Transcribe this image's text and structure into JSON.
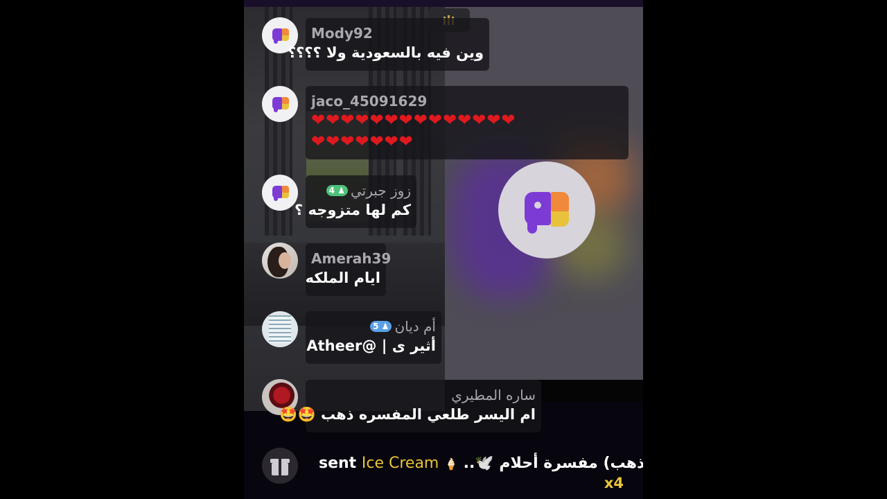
{
  "colors": {
    "accent": "#e9c43a",
    "heart": "#e0191f",
    "username": "#aaa8ae"
  },
  "comments": [
    {
      "username": "Mody92",
      "message": "وين فيه بالسعودية ولا ؟؟؟؟",
      "avatar": "app-logo-icon"
    },
    {
      "username": "jaco_45091629",
      "hearts_line1": "❤❤❤❤❤❤❤❤❤❤❤❤❤❤",
      "hearts_line2": "❤❤❤❤❤❤❤",
      "avatar": "app-logo-icon"
    },
    {
      "username": "زوز جبرتي",
      "level": "4",
      "message": "كم لها متزوجه ؟",
      "avatar": "app-logo-icon"
    },
    {
      "username": "Amerah39",
      "message": "ايام الملكه",
      "avatar": "user-photo"
    },
    {
      "username": "أم ديان",
      "level": "5",
      "message": "أثير ى | @Atheer",
      "avatar": "user-photo"
    },
    {
      "username": "ساره المطيري",
      "message": "ام اليسر طلعي المفسره ذهب 🤩🤩",
      "avatar": "user-photo"
    }
  ],
  "gift": {
    "sender": "(ذهب) مفسرة أحلام 🕊️..",
    "sent_label": "sent",
    "gift_name": "Ice Cream",
    "gift_icon": "ice-cream-icon",
    "multiplier": "x4"
  }
}
